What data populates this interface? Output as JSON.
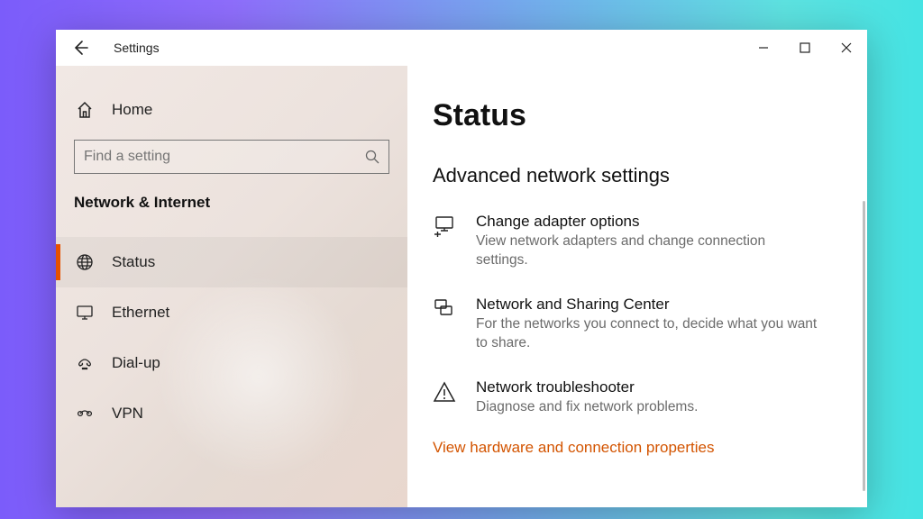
{
  "titlebar": {
    "title": "Settings"
  },
  "sidebar": {
    "home_label": "Home",
    "search_placeholder": "Find a setting",
    "section_label": "Network & Internet",
    "items": [
      {
        "label": "Status",
        "icon": "globe-icon",
        "active": true
      },
      {
        "label": "Ethernet",
        "icon": "monitor-icon",
        "active": false
      },
      {
        "label": "Dial-up",
        "icon": "phone-icon",
        "active": false
      },
      {
        "label": "VPN",
        "icon": "vpn-icon",
        "active": false
      }
    ]
  },
  "main": {
    "heading": "Status",
    "subheading": "Advanced network settings",
    "options": [
      {
        "title": "Change adapter options",
        "desc": "View network adapters and change connection settings."
      },
      {
        "title": "Network and Sharing Center",
        "desc": "For the networks you connect to, decide what you want to share."
      },
      {
        "title": "Network troubleshooter",
        "desc": "Diagnose and fix network problems."
      }
    ],
    "link": "View hardware and connection properties"
  }
}
